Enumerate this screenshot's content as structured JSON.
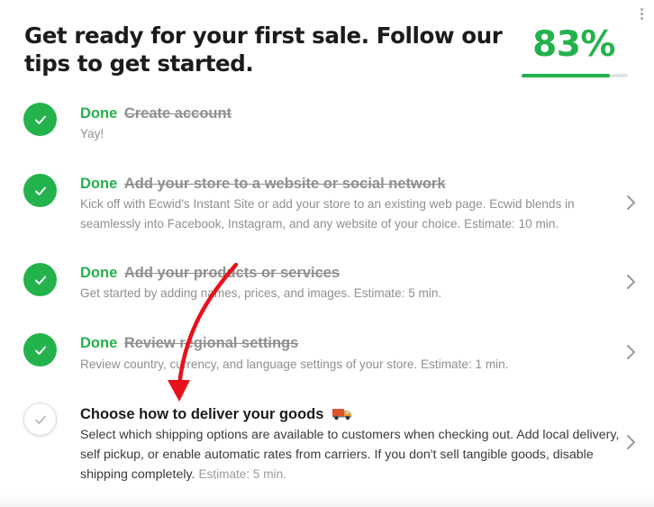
{
  "header": {
    "title": "Get ready for your first sale. Follow our tips to get started.",
    "progress_text": "83%",
    "progress_fraction": 0.83
  },
  "colors": {
    "accent": "#24b24c",
    "muted": "#8f8f8f",
    "annotation": "#e8111b"
  },
  "steps": [
    {
      "status": "Done",
      "title": "Create account",
      "description": "Yay!",
      "has_chevron": false
    },
    {
      "status": "Done",
      "title": "Add your store to a website or social network",
      "description": "Kick off with Ecwid's Instant Site or add your store to an existing web page. Ecwid blends in seamlessly into Facebook, Instagram, and any website of your choice. Estimate: 10 min.",
      "has_chevron": true
    },
    {
      "status": "Done",
      "title": "Add your products or services",
      "description": "Get started by adding names, prices, and images. Estimate: 5 min.",
      "has_chevron": true
    },
    {
      "status": "Done",
      "title": "Review regional settings",
      "description": "Review country, currency, and language settings of your store. Estimate: 1 min.",
      "has_chevron": true
    },
    {
      "status": "",
      "title": "Choose how to deliver your goods",
      "title_icon": "delivery-truck-icon",
      "description": "Select which shipping options are available to customers when checking out. Add local delivery, self pickup, or enable automatic rates from carriers. If you don't sell tangible goods, disable shipping completely.",
      "estimate": "Estimate: 5 min.",
      "has_chevron": true
    }
  ]
}
